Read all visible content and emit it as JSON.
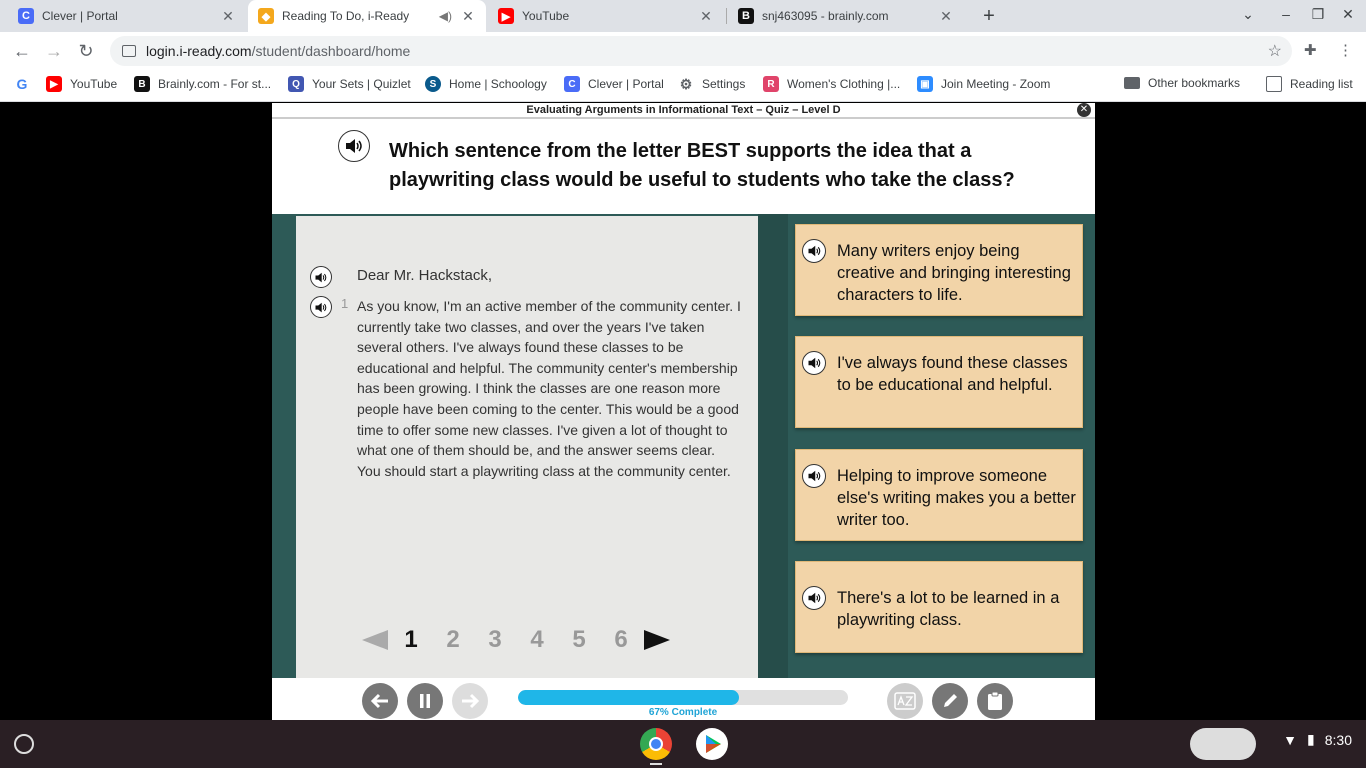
{
  "tabs": [
    {
      "title": "Clever | Portal",
      "favicon": "C",
      "color": "#4a6cf7"
    },
    {
      "title": "Reading To Do, i-Ready",
      "favicon": "◆",
      "color": "#f4a81d"
    },
    {
      "title": "YouTube",
      "favicon": "▶",
      "color": "#ff0000"
    },
    {
      "title": "snj463095 - brainly.com",
      "favicon": "B",
      "color": "#111111"
    }
  ],
  "address": {
    "host": "login.i-ready.com",
    "path": "/student/dashboard/home"
  },
  "bookmarks": [
    {
      "label": "YouTube",
      "favicon": "▶",
      "color": "#ff0000"
    },
    {
      "label": "Brainly.com - For st...",
      "favicon": "B",
      "color": "#111111"
    },
    {
      "label": "Your Sets | Quizlet",
      "favicon": "Q",
      "color": "#4257b2"
    },
    {
      "label": "Home | Schoology",
      "favicon": "S",
      "color": "#0a5a8c"
    },
    {
      "label": "Clever | Portal",
      "favicon": "C",
      "color": "#4a6cf7"
    },
    {
      "label": "Settings",
      "favicon": "⚙",
      "color": "#5f6368"
    },
    {
      "label": "Women's Clothing |...",
      "favicon": "R",
      "color": "#e0446a"
    },
    {
      "label": "Join Meeting - Zoom",
      "favicon": "▣",
      "color": "#2d8cff"
    }
  ],
  "other_bookmarks": "Other bookmarks",
  "reading_list": "Reading list",
  "quiz": {
    "title": "Evaluating Arguments in Informational Text – Quiz – Level D",
    "question": "Which sentence from the letter BEST supports the idea that a playwriting class would be useful to students who take the class?",
    "greeting": "Dear Mr. Hackstack,",
    "para_number": "1",
    "paragraph": "As you know, I'm an active member of the community center. I currently take two classes, and over the years I've taken several others. I've always found these classes to be educational and helpful. The community center's membership has been growing. I think the classes are one reason more people have been coming to the center. This would be a good time to offer some new classes. I've given a lot of thought to what one of them should be, and the answer seems clear. You should start a playwriting class at the community center.",
    "pages": [
      "1",
      "2",
      "3",
      "4",
      "5",
      "6"
    ],
    "current_page": "1",
    "answers": [
      "Many writers enjoy being creative and bringing interesting characters to life.",
      "I've always found these classes to be educational and helpful.",
      "Helping to improve someone else's writing makes you a better writer too.",
      "There's a lot to be learned in a playwriting class."
    ],
    "progress_percent": 67,
    "progress_label": "67% Complete"
  },
  "clock": "8:30"
}
